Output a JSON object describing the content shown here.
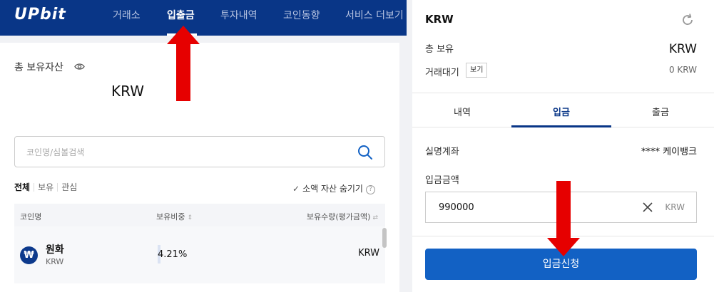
{
  "nav": {
    "logo": "UPbit",
    "items": [
      {
        "label": "거래소",
        "active": false
      },
      {
        "label": "입출금",
        "active": true
      },
      {
        "label": "투자내역",
        "active": false
      },
      {
        "label": "코인동향",
        "active": false
      },
      {
        "label": "서비스 더보기",
        "active": false
      }
    ]
  },
  "assets": {
    "total_label": "총 보유자산",
    "total_unit": "KRW"
  },
  "search": {
    "placeholder": "코인명/심볼검색"
  },
  "filters": [
    "전체",
    "보유",
    "관심"
  ],
  "hide_small_label": "소액 자산 숨기기",
  "table": {
    "headers": {
      "coin": "코인명",
      "ratio": "보유비중",
      "qty": "보유수량(평가금액)"
    },
    "rows": [
      {
        "symbol": "₩",
        "name": "원화",
        "code": "KRW",
        "ratio": "4.21%",
        "qty_unit": "KRW"
      }
    ]
  },
  "deposit": {
    "title": "KRW",
    "hold_label": "총 보유",
    "hold_unit": "KRW",
    "pending_label": "거래대기",
    "view_button": "보기",
    "pending_value": "0 KRW",
    "tabs": [
      {
        "label": "내역",
        "active": false
      },
      {
        "label": "입금",
        "active": true
      },
      {
        "label": "출금",
        "active": false
      }
    ],
    "account_label": "실명계좌",
    "account_value": "**** 케이뱅크",
    "amount_label": "입금금액",
    "amount_value": "990000",
    "amount_unit": "KRW",
    "submit_label": "입금신청"
  },
  "colors": {
    "nav_bg": "#093687",
    "primary_button": "#1261c4",
    "annotation_arrow": "#e60000"
  },
  "icons": [
    "eye-icon",
    "search-icon",
    "check-icon",
    "help-icon",
    "sort-icon",
    "refresh-icon",
    "clear-icon",
    "arrow-up-annotation",
    "arrow-down-annotation"
  ]
}
